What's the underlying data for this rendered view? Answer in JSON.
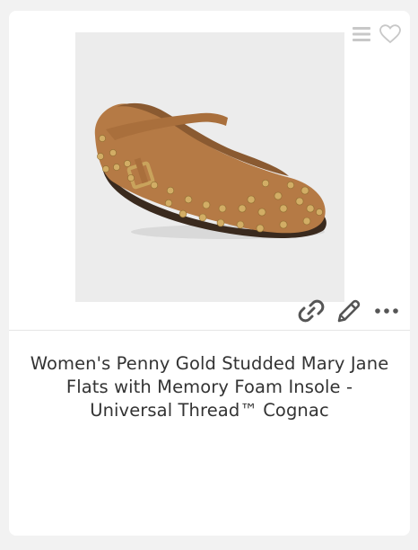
{
  "product": {
    "title": "Women's Penny Gold Studded Mary Jane Flats with Memory Foam Insole - Universal Thread™ Cognac",
    "image_alt": "Cognac studded Mary Jane flat shoe"
  },
  "icons": {
    "menu": "menu-icon",
    "favorite": "heart-icon",
    "link": "link-icon",
    "edit": "pencil-icon",
    "more": "more-icon"
  },
  "colors": {
    "icon_light": "#c8c8c8",
    "icon_dark": "#555555",
    "shoe": "#b57a45",
    "stud": "#c9a35c"
  }
}
